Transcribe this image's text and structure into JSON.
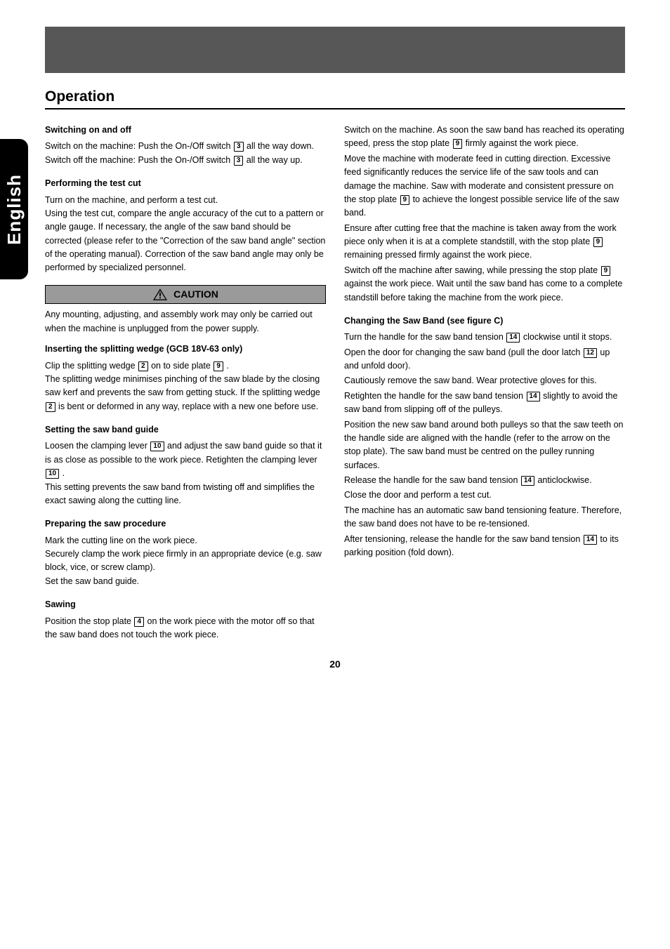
{
  "sideTab": "English",
  "sectionTitle": "Operation",
  "cautionLabel": "CAUTION",
  "left": {
    "h1": "Switching on and off",
    "p1a": "Switch on the machine: Push the On-/Off switch",
    "p1b": " all the way down.",
    "p2a": "Switch off the machine: Push the On-/Off switch",
    "p2b": " all the way up.",
    "h2": "Performing the test cut",
    "p3": "Turn on the machine, and perform a test cut.",
    "p4": "Using the test cut, compare the angle accuracy of the cut to a pattern or angle gauge. If necessary, the angle of the saw band should be corrected (please refer to the \"Correction of the saw band angle\" section of the operating manual). Correction of the saw band angle may only be performed by specialized personnel.",
    "caution1": "Any mounting, adjusting, and assembly work may only be carried out when the machine is unplugged from the power supply.",
    "h3": "Inserting the splitting wedge (GCB 18V-63 only)",
    "p5a": "Clip the splitting wedge ",
    "p5b": " on to side plate ",
    "p5c": ".",
    "p6a": "The splitting wedge minimises pinching of the saw blade by the closing saw kerf and prevents the saw from getting stuck. If the splitting wedge ",
    "p6b": " is bent or deformed in any way, replace with a new one before use.",
    "h4": "Setting the saw band guide",
    "p7a": "Loosen the clamping lever ",
    "p7b": " and adjust the saw band guide so that it is as close as possible to the work piece. Retighten the clamping lever ",
    "p7c": ".",
    "p8": "This setting prevents the saw band from twisting off and simplifies the exact sawing along the cutting line.",
    "h5": "Preparing the saw procedure",
    "p9": "Mark the cutting line on the work piece.",
    "p10": "Securely clamp the work piece firmly in an appropriate device (e.g. saw block, vice, or screw clamp).",
    "p11": "Set the saw band guide.",
    "h6": "Sawing",
    "p12a": "Position the stop plate ",
    "p12b": " on the work piece with the motor off so that the saw band does not touch the work piece."
  },
  "right": {
    "p1a": "Switch on the machine. As soon the saw band has reached its operating speed, press the stop plate ",
    "p1b": " firmly against the work piece.",
    "p2a": "Move the machine with moderate feed in cutting direction. Excessive feed significantly reduces the service life of the saw tools and can damage the machine. Saw with moderate and consistent pressure on the stop plate ",
    "p2b": " to achieve the longest possible service life of the saw band.",
    "p3a": "Ensure after cutting free that the machine is taken away from the work piece only when it is at a complete standstill, with the stop plate ",
    "p3b": " remaining pressed firmly against the work piece.",
    "p4a": "Switch off the machine after sawing, while pressing the stop plate ",
    "p4b": " against the work piece. Wait until the saw band has come to a complete standstill before taking the machine from the work piece.",
    "hA": "Changing the Saw Band (see figure C)",
    "pAa": "Turn the handle for the saw band tension ",
    "pAb": " clockwise until it stops.",
    "pBa": "Open the door for changing the saw band (pull the door latch ",
    "pBb": " up and unfold door).",
    "pC": "Cautiously remove the saw band. Wear protective gloves for this.",
    "pDa": "Retighten the handle for the saw band tension ",
    "pDb": " slightly to avoid the saw band from slipping off of the pulleys.",
    "pE": "Position the new saw band around both pulleys so that the saw teeth on the handle side are aligned with the handle (refer to the arrow on the stop plate). The saw band must be centred on the pulley running surfaces.",
    "pFa": "Release the handle for the saw band tension ",
    "pFb": " anticlockwise.",
    "pG": "Close the door and perform a test cut.",
    "pH": "The machine has an automatic saw band tensioning feature. Therefore, the saw band does not have to be re-tensioned.",
    "pIa": "After tensioning, release the handle for the saw band tension ",
    "pIb": " to its parking position (fold down)."
  },
  "pageNumber": "20"
}
